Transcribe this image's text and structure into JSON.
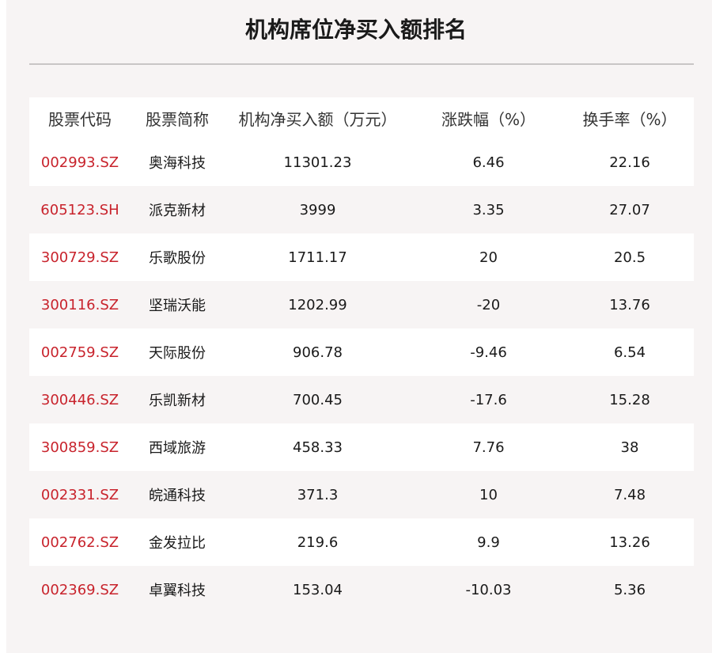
{
  "title": "机构席位净买入额排名",
  "chart_data": {
    "type": "table",
    "columns": [
      "股票代码",
      "股票简称",
      "机构净买入额（万元）",
      "涨跌幅（%）",
      "换手率（%）"
    ],
    "rows": [
      [
        "002993.SZ",
        "奥海科技",
        "11301.23",
        "6.46",
        "22.16"
      ],
      [
        "605123.SH",
        "派克新材",
        "3999",
        "3.35",
        "27.07"
      ],
      [
        "300729.SZ",
        "乐歌股份",
        "1711.17",
        "20",
        "20.5"
      ],
      [
        "300116.SZ",
        "坚瑞沃能",
        "1202.99",
        "-20",
        "13.76"
      ],
      [
        "002759.SZ",
        "天际股份",
        "906.78",
        "-9.46",
        "6.54"
      ],
      [
        "300446.SZ",
        "乐凯新材",
        "700.45",
        "-17.6",
        "15.28"
      ],
      [
        "300859.SZ",
        "西域旅游",
        "458.33",
        "7.76",
        "38"
      ],
      [
        "002331.SZ",
        "皖通科技",
        "371.3",
        "10",
        "7.48"
      ],
      [
        "002762.SZ",
        "金发拉比",
        "219.6",
        "9.9",
        "13.26"
      ],
      [
        "002369.SZ",
        "卓翼科技",
        "153.04",
        "-10.03",
        "5.36"
      ]
    ]
  },
  "colors": {
    "code_text": "#c8232c",
    "background": "#f7f4f4",
    "row_white": "#ffffff"
  }
}
